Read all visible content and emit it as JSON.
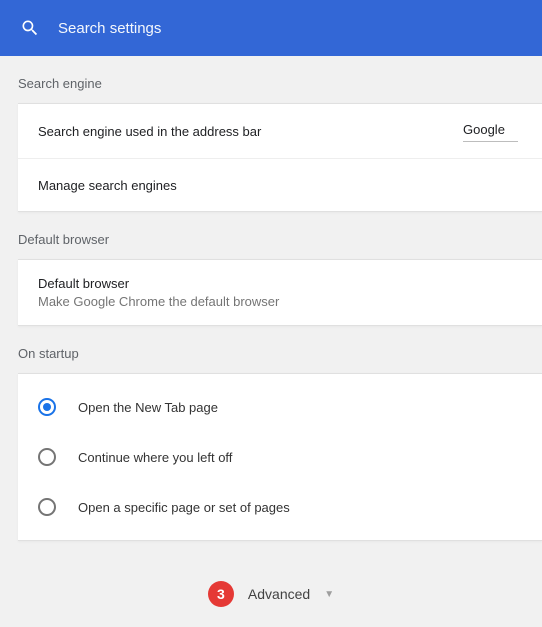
{
  "search": {
    "placeholder": "Search settings"
  },
  "sections": {
    "searchEngine": {
      "heading": "Search engine",
      "row1_prefix": "Search engine used in the ",
      "row1_link": "address bar",
      "row1_value": "Google",
      "row2": "Manage search engines"
    },
    "defaultBrowser": {
      "heading": "Default browser",
      "title": "Default browser",
      "sub": "Make Google Chrome the default browser"
    },
    "startup": {
      "heading": "On startup",
      "options": [
        {
          "label": "Open the New Tab page",
          "selected": true
        },
        {
          "label": "Continue where you left off",
          "selected": false
        },
        {
          "label": "Open a specific page or set of pages",
          "selected": false
        }
      ]
    }
  },
  "advanced": {
    "badge": "3",
    "label": "Advanced"
  }
}
